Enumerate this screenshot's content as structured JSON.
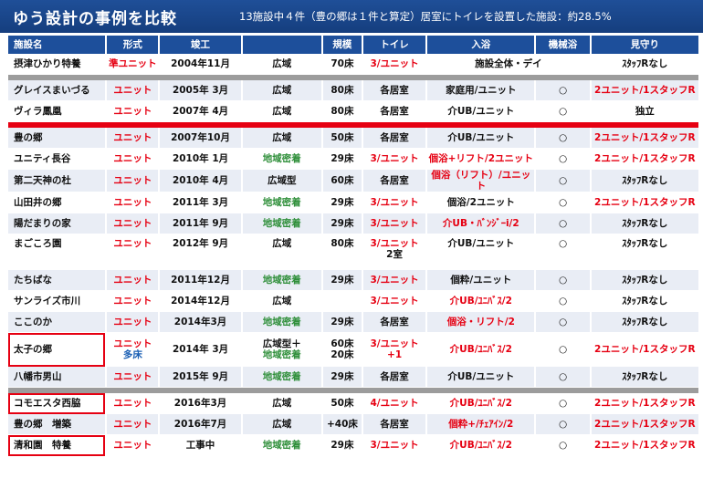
{
  "title": "ゆう設計の事例を比較",
  "subtitle": "13施設中４件（豊の郷は１件と算定）居室にトイレを設置した施設：約28.5%",
  "headers": [
    "施設名",
    "形式",
    "竣工",
    "",
    "規模",
    "トイレ",
    "入浴",
    "機械浴",
    "見守り"
  ],
  "rows": [
    {
      "name": "摂津ひかり特養",
      "form": "準ユニット",
      "built": "2004年11月",
      "area": "広域",
      "size": "70床",
      "toilet": "3/ユニット",
      "bath": "施設全体・デイ",
      "mech": "",
      "watch": "ｽﾀｯﾌRなし"
    },
    {
      "name": "グレイスまいづる",
      "form": "ユニット",
      "built": "2005年 3月",
      "area": "広域",
      "size": "80床",
      "toilet": "各居室",
      "bath": "家庭用/ユニット",
      "mech": "○",
      "watch": "2ユニット/1スタッフR"
    },
    {
      "name": "ヴィラ鳳凰",
      "form": "ユニット",
      "built": "2007年 4月",
      "area": "広域",
      "size": "80床",
      "toilet": "各居室",
      "bath": "介UB/ユニット",
      "mech": "○",
      "watch": "独立"
    },
    {
      "name": "豊の郷",
      "form": "ユニット",
      "built": "2007年10月",
      "area": "広域",
      "size": "50床",
      "toilet": "各居室",
      "bath": "介UB/ユニット",
      "mech": "○",
      "watch": "2ユニット/1スタッフR"
    },
    {
      "name": "ユニティ長谷",
      "form": "ユニット",
      "built": "2010年 1月",
      "area": "地域密着",
      "size": "29床",
      "toilet": "3/ユニット",
      "bath": "個浴+リフト/2ユニット",
      "mech": "○",
      "watch": "2ユニット/1スタッフR"
    },
    {
      "name": "第二天神の杜",
      "form": "ユニット",
      "built": "2010年 4月",
      "area": "広域型",
      "size": "60床",
      "toilet": "各居室",
      "bath": "個浴（リフト）/ユニット",
      "mech": "○",
      "watch": "ｽﾀｯﾌRなし"
    },
    {
      "name": "山田井の郷",
      "form": "ユニット",
      "built": "2011年 3月",
      "area": "地域密着",
      "size": "29床",
      "toilet": "3/ユニット",
      "bath": "個浴/2ユニット",
      "mech": "○",
      "watch": "2ユニット/1スタッフR"
    },
    {
      "name": "陽だまりの家",
      "form": "ユニット",
      "built": "2011年 9月",
      "area": "地域密着",
      "size": "29床",
      "toilet": "3/ユニット",
      "bath": "介UB・ﾊﾞﾝｼﾞｰi/2",
      "mech": "○",
      "watch": "ｽﾀｯﾌRなし"
    },
    {
      "name": "まごころ園",
      "form": "ユニット",
      "built": "2012年 9月",
      "area": "広域",
      "size": "80床",
      "toilet": "3/ユニット",
      "toilet2": "2室",
      "bath": "介UB/ユニット",
      "mech": "○",
      "watch": "ｽﾀｯﾌRなし"
    },
    {
      "name": "たちばな",
      "form": "ユニット",
      "built": "2011年12月",
      "area": "地域密着",
      "size": "29床",
      "toilet": "3/ユニット",
      "bath": "個粋/ユニット",
      "mech": "○",
      "watch": "ｽﾀｯﾌRなし"
    },
    {
      "name": "サンライズ市川",
      "form": "ユニット",
      "built": "2014年12月",
      "area": "広域",
      "size": "",
      "toilet": "3/ユニット",
      "bath": "介UB/ﾕﾆﾊﾞｽ/2",
      "mech": "○",
      "watch": "ｽﾀｯﾌRなし"
    },
    {
      "name": "ここのか",
      "form": "ユニット",
      "built": "2014年3月",
      "area": "地域密着",
      "size": "29床",
      "toilet": "各居室",
      "bath": "個浴・リフト/2",
      "mech": "○",
      "watch": "ｽﾀｯﾌRなし"
    },
    {
      "name": "太子の郷",
      "form": "ユニット",
      "form2": "多床",
      "built": "2014年 3月",
      "area": "広域型＋",
      "area2": "地域密着",
      "size": "60床",
      "size2": "20床",
      "toilet": "3/ユニット+1",
      "bath": "介UB/ﾕﾆﾊﾞｽ/2",
      "mech": "○",
      "watch": "2ユニット/1スタッフR"
    },
    {
      "name": "八幡市男山",
      "form": "ユニット",
      "built": "2015年 9月",
      "area": "地域密着",
      "size": "29床",
      "toilet": "各居室",
      "bath": "介UB/ユニット",
      "mech": "○",
      "watch": "ｽﾀｯﾌRなし"
    },
    {
      "name": "コモエスタ西脇",
      "form": "ユニット",
      "built": "2016年3月",
      "area": "広域",
      "size": "50床",
      "toilet": "4/ユニット",
      "bath": "介UB/ﾕﾆﾊﾞｽ/2",
      "mech": "○",
      "watch": "2ユニット/1スタッフR"
    },
    {
      "name": "豊の郷　増築",
      "form": "ユニット",
      "built": "2016年7月",
      "area": "広域",
      "size": "+40床",
      "toilet": "各居室",
      "bath": "個粋+/ﾁｪｱｲﾝ/2",
      "mech": "○",
      "watch": "2ユニット/1スタッフR"
    },
    {
      "name": "清和園　特養",
      "form": "ユニット",
      "built": "工事中",
      "area": "地域密着",
      "size": "29床",
      "toilet": "3/ユニット",
      "bath": "介UB/ﾕﾆﾊﾞｽ/2",
      "mech": "○",
      "watch": "2ユニット/1スタッフR"
    }
  ]
}
